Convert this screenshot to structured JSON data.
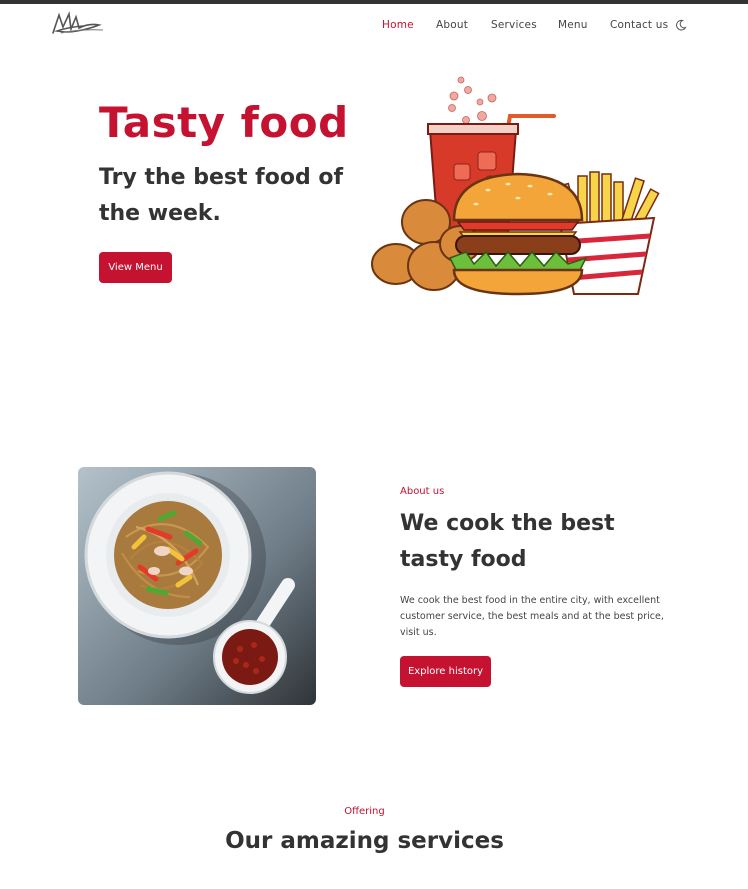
{
  "nav": {
    "home": "Home",
    "about": "About",
    "services": "Services",
    "menu": "Menu",
    "contact": "Contact us"
  },
  "hero": {
    "title": "Tasty food",
    "subtitle": "Try the best food of the week.",
    "button": "View Menu"
  },
  "about": {
    "kicker": "About us",
    "title": "We cook the best tasty food",
    "text": "We cook the best food in the entire city, with excellent customer service, the best meals and at the best price, visit us.",
    "button": "Explore history"
  },
  "offering": {
    "kicker": "Offering",
    "title": "Our amazing services"
  },
  "icons": {
    "logo": "signature-logo",
    "theme": "moon-icon"
  },
  "colors": {
    "accent": "#c41230",
    "text": "#333333",
    "topbar": "#333333"
  }
}
